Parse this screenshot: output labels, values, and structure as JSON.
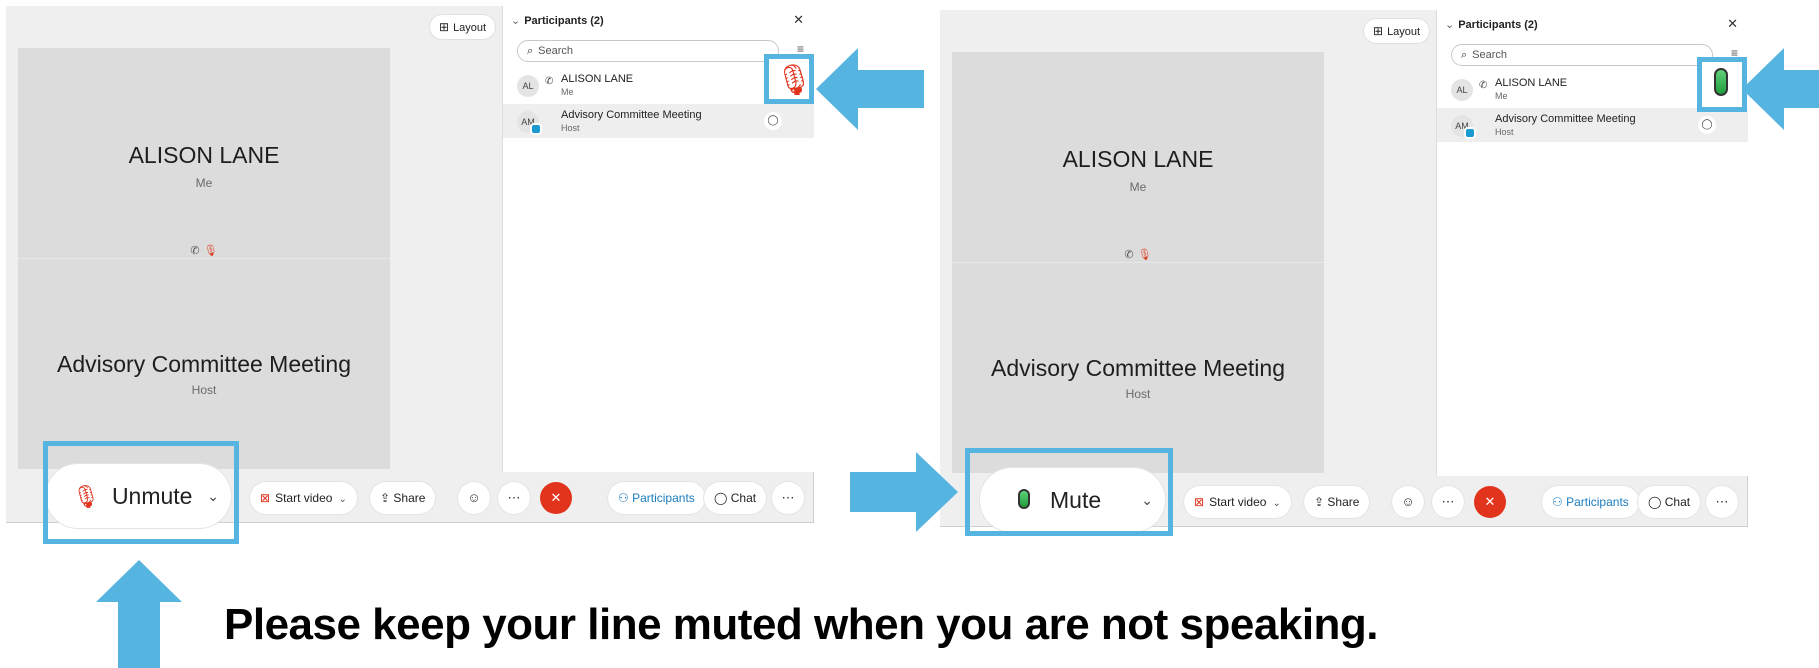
{
  "left": {
    "layout_label": "Layout",
    "tile1": {
      "name": "ALISON LANE",
      "sub": "Me"
    },
    "tile2": {
      "name": "Advisory Committee Meeting",
      "sub": "Host"
    },
    "sidebar": {
      "title": "Participants (2)",
      "search_placeholder": "Search",
      "participants": [
        {
          "initials": "AL",
          "name": "ALISON LANE",
          "role": "Me"
        },
        {
          "initials": "AM",
          "name": "Advisory Committee Meeting",
          "role": "Host"
        }
      ]
    },
    "mute_button_label": "Unmute",
    "start_video_label": "Start video",
    "share_label": "Share",
    "participants_tab_label": "Participants",
    "chat_tab_label": "Chat"
  },
  "right": {
    "layout_label": "Layout",
    "tile1": {
      "name": "ALISON LANE",
      "sub": "Me"
    },
    "tile2": {
      "name": "Advisory Committee Meeting",
      "sub": "Host"
    },
    "sidebar": {
      "title": "Participants (2)",
      "search_placeholder": "Search",
      "participants": [
        {
          "initials": "AL",
          "name": "ALISON LANE",
          "role": "Me"
        },
        {
          "initials": "AM",
          "name": "Advisory Committee Meeting",
          "role": "Host"
        }
      ]
    },
    "mute_button_label": "Mute",
    "start_video_label": "Start video",
    "share_label": "Share",
    "participants_tab_label": "Participants",
    "chat_tab_label": "Chat"
  },
  "caption": "Please keep your line muted when you are not speaking.",
  "colors": {
    "highlight": "#56b4e0",
    "end_call": "#e2341d",
    "muted_red": "#e2341d",
    "unmuted_green": "#2fb24d"
  }
}
